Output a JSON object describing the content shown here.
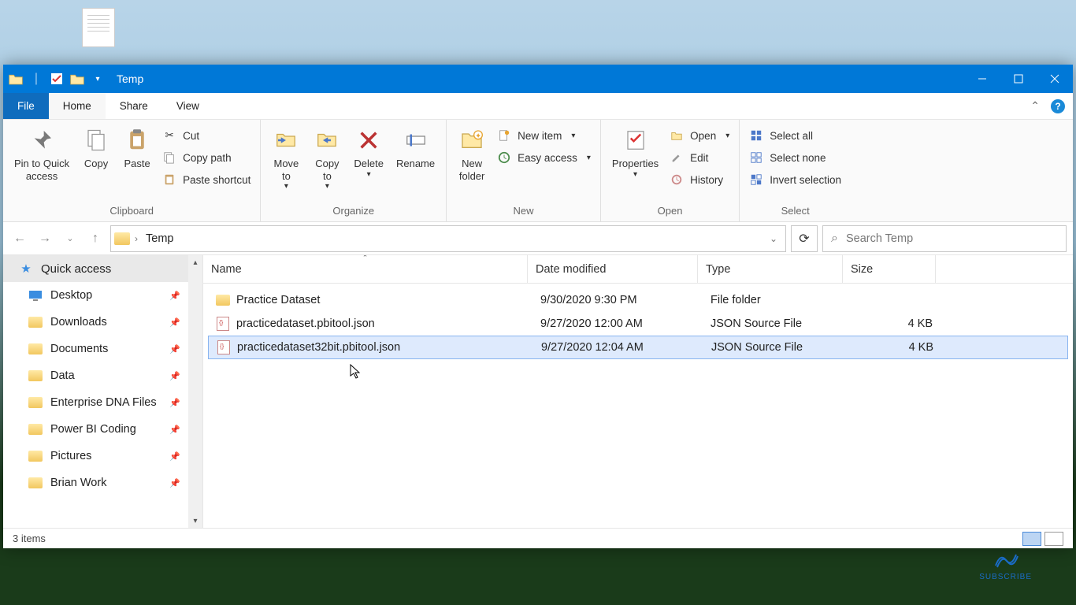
{
  "window": {
    "title": "Temp",
    "tabs": {
      "file": "File",
      "home": "Home",
      "share": "Share",
      "view": "View"
    }
  },
  "ribbon": {
    "clipboard": {
      "label": "Clipboard",
      "pin": "Pin to Quick\naccess",
      "copy": "Copy",
      "paste": "Paste",
      "cut": "Cut",
      "copypath": "Copy path",
      "pasteshortcut": "Paste shortcut"
    },
    "organize": {
      "label": "Organize",
      "moveto": "Move\nto",
      "copyto": "Copy\nto",
      "delete": "Delete",
      "rename": "Rename"
    },
    "new": {
      "label": "New",
      "newfolder": "New\nfolder",
      "newitem": "New item",
      "easyaccess": "Easy access"
    },
    "open": {
      "label": "Open",
      "properties": "Properties",
      "open": "Open",
      "edit": "Edit",
      "history": "History"
    },
    "select": {
      "label": "Select",
      "selectall": "Select all",
      "selectnone": "Select none",
      "invert": "Invert selection"
    }
  },
  "address": {
    "location": "Temp"
  },
  "search": {
    "placeholder": "Search Temp"
  },
  "sidebar": {
    "quickaccess": "Quick access",
    "items": [
      {
        "label": "Desktop",
        "icon": "desktop"
      },
      {
        "label": "Downloads",
        "icon": "folder"
      },
      {
        "label": "Documents",
        "icon": "folder"
      },
      {
        "label": "Data",
        "icon": "folder"
      },
      {
        "label": "Enterprise DNA Files",
        "icon": "folder"
      },
      {
        "label": "Power BI Coding",
        "icon": "folder"
      },
      {
        "label": "Pictures",
        "icon": "folder"
      },
      {
        "label": "Brian Work",
        "icon": "folder"
      }
    ]
  },
  "columns": {
    "name": "Name",
    "date": "Date modified",
    "type": "Type",
    "size": "Size"
  },
  "files": [
    {
      "name": "Practice Dataset",
      "date": "9/30/2020 9:30 PM",
      "type": "File folder",
      "size": "",
      "kind": "folder"
    },
    {
      "name": "practicedataset.pbitool.json",
      "date": "9/27/2020 12:00 AM",
      "type": "JSON Source File",
      "size": "4 KB",
      "kind": "json"
    },
    {
      "name": "practicedataset32bit.pbitool.json",
      "date": "9/27/2020 12:04 AM",
      "type": "JSON Source File",
      "size": "4 KB",
      "kind": "json"
    }
  ],
  "status": "3 items"
}
